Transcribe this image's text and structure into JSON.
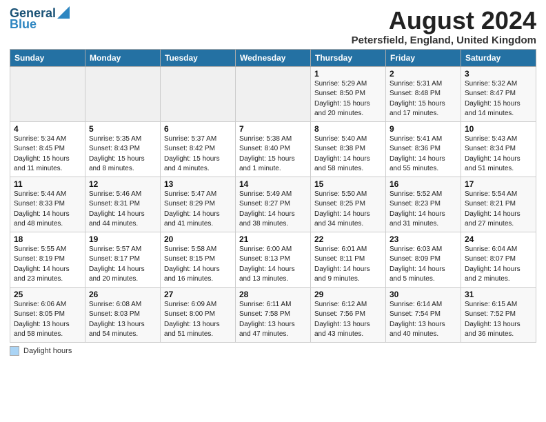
{
  "header": {
    "logo_line1": "General",
    "logo_line2": "Blue",
    "title": "August 2024",
    "subtitle": "Petersfield, England, United Kingdom"
  },
  "weekdays": [
    "Sunday",
    "Monday",
    "Tuesday",
    "Wednesday",
    "Thursday",
    "Friday",
    "Saturday"
  ],
  "weeks": [
    [
      {
        "day": "",
        "info": ""
      },
      {
        "day": "",
        "info": ""
      },
      {
        "day": "",
        "info": ""
      },
      {
        "day": "",
        "info": ""
      },
      {
        "day": "1",
        "info": "Sunrise: 5:29 AM\nSunset: 8:50 PM\nDaylight: 15 hours\nand 20 minutes."
      },
      {
        "day": "2",
        "info": "Sunrise: 5:31 AM\nSunset: 8:48 PM\nDaylight: 15 hours\nand 17 minutes."
      },
      {
        "day": "3",
        "info": "Sunrise: 5:32 AM\nSunset: 8:47 PM\nDaylight: 15 hours\nand 14 minutes."
      }
    ],
    [
      {
        "day": "4",
        "info": "Sunrise: 5:34 AM\nSunset: 8:45 PM\nDaylight: 15 hours\nand 11 minutes."
      },
      {
        "day": "5",
        "info": "Sunrise: 5:35 AM\nSunset: 8:43 PM\nDaylight: 15 hours\nand 8 minutes."
      },
      {
        "day": "6",
        "info": "Sunrise: 5:37 AM\nSunset: 8:42 PM\nDaylight: 15 hours\nand 4 minutes."
      },
      {
        "day": "7",
        "info": "Sunrise: 5:38 AM\nSunset: 8:40 PM\nDaylight: 15 hours\nand 1 minute."
      },
      {
        "day": "8",
        "info": "Sunrise: 5:40 AM\nSunset: 8:38 PM\nDaylight: 14 hours\nand 58 minutes."
      },
      {
        "day": "9",
        "info": "Sunrise: 5:41 AM\nSunset: 8:36 PM\nDaylight: 14 hours\nand 55 minutes."
      },
      {
        "day": "10",
        "info": "Sunrise: 5:43 AM\nSunset: 8:34 PM\nDaylight: 14 hours\nand 51 minutes."
      }
    ],
    [
      {
        "day": "11",
        "info": "Sunrise: 5:44 AM\nSunset: 8:33 PM\nDaylight: 14 hours\nand 48 minutes."
      },
      {
        "day": "12",
        "info": "Sunrise: 5:46 AM\nSunset: 8:31 PM\nDaylight: 14 hours\nand 44 minutes."
      },
      {
        "day": "13",
        "info": "Sunrise: 5:47 AM\nSunset: 8:29 PM\nDaylight: 14 hours\nand 41 minutes."
      },
      {
        "day": "14",
        "info": "Sunrise: 5:49 AM\nSunset: 8:27 PM\nDaylight: 14 hours\nand 38 minutes."
      },
      {
        "day": "15",
        "info": "Sunrise: 5:50 AM\nSunset: 8:25 PM\nDaylight: 14 hours\nand 34 minutes."
      },
      {
        "day": "16",
        "info": "Sunrise: 5:52 AM\nSunset: 8:23 PM\nDaylight: 14 hours\nand 31 minutes."
      },
      {
        "day": "17",
        "info": "Sunrise: 5:54 AM\nSunset: 8:21 PM\nDaylight: 14 hours\nand 27 minutes."
      }
    ],
    [
      {
        "day": "18",
        "info": "Sunrise: 5:55 AM\nSunset: 8:19 PM\nDaylight: 14 hours\nand 23 minutes."
      },
      {
        "day": "19",
        "info": "Sunrise: 5:57 AM\nSunset: 8:17 PM\nDaylight: 14 hours\nand 20 minutes."
      },
      {
        "day": "20",
        "info": "Sunrise: 5:58 AM\nSunset: 8:15 PM\nDaylight: 14 hours\nand 16 minutes."
      },
      {
        "day": "21",
        "info": "Sunrise: 6:00 AM\nSunset: 8:13 PM\nDaylight: 14 hours\nand 13 minutes."
      },
      {
        "day": "22",
        "info": "Sunrise: 6:01 AM\nSunset: 8:11 PM\nDaylight: 14 hours\nand 9 minutes."
      },
      {
        "day": "23",
        "info": "Sunrise: 6:03 AM\nSunset: 8:09 PM\nDaylight: 14 hours\nand 5 minutes."
      },
      {
        "day": "24",
        "info": "Sunrise: 6:04 AM\nSunset: 8:07 PM\nDaylight: 14 hours\nand 2 minutes."
      }
    ],
    [
      {
        "day": "25",
        "info": "Sunrise: 6:06 AM\nSunset: 8:05 PM\nDaylight: 13 hours\nand 58 minutes."
      },
      {
        "day": "26",
        "info": "Sunrise: 6:08 AM\nSunset: 8:03 PM\nDaylight: 13 hours\nand 54 minutes."
      },
      {
        "day": "27",
        "info": "Sunrise: 6:09 AM\nSunset: 8:00 PM\nDaylight: 13 hours\nand 51 minutes."
      },
      {
        "day": "28",
        "info": "Sunrise: 6:11 AM\nSunset: 7:58 PM\nDaylight: 13 hours\nand 47 minutes."
      },
      {
        "day": "29",
        "info": "Sunrise: 6:12 AM\nSunset: 7:56 PM\nDaylight: 13 hours\nand 43 minutes."
      },
      {
        "day": "30",
        "info": "Sunrise: 6:14 AM\nSunset: 7:54 PM\nDaylight: 13 hours\nand 40 minutes."
      },
      {
        "day": "31",
        "info": "Sunrise: 6:15 AM\nSunset: 7:52 PM\nDaylight: 13 hours\nand 36 minutes."
      }
    ]
  ],
  "legend": {
    "label": "Daylight hours"
  }
}
